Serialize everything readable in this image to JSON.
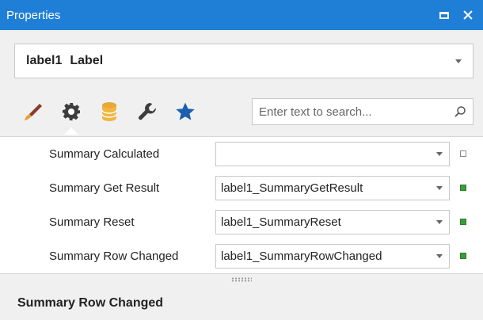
{
  "titlebar": {
    "title": "Properties"
  },
  "object_selector": {
    "name": "label1",
    "type": "Label"
  },
  "toolbar": {
    "tools": [
      {
        "icon": "brush-icon"
      },
      {
        "icon": "gear-icon"
      },
      {
        "icon": "database-icon"
      },
      {
        "icon": "wrench-icon"
      },
      {
        "icon": "star-icon"
      }
    ],
    "search_placeholder": "Enter text to search..."
  },
  "properties": [
    {
      "name": "Summary Calculated",
      "value": "",
      "marker": "empty"
    },
    {
      "name": "Summary Get Result",
      "value": "label1_SummaryGetResult",
      "marker": "set"
    },
    {
      "name": "Summary Reset",
      "value": "label1_SummaryReset",
      "marker": "set"
    },
    {
      "name": "Summary Row Changed",
      "value": "label1_SummaryRowChanged",
      "marker": "set"
    }
  ],
  "description": {
    "title": "Summary Row Changed"
  },
  "colors": {
    "titlebar": "#1f7fd6",
    "star": "#1b5fad",
    "marker_set": "#3a9c3a"
  }
}
